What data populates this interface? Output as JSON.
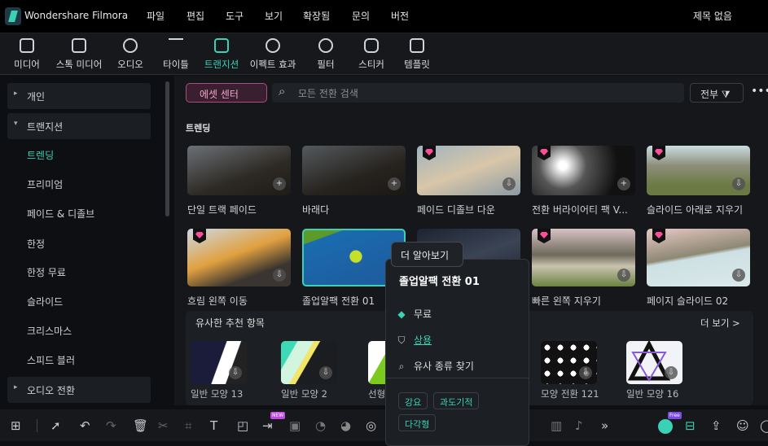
{
  "app": {
    "title": "Wondershare Filmora",
    "project_title": "제목 없음"
  },
  "menu": [
    "파일",
    "편집",
    "도구",
    "보기",
    "확장됨",
    "문의",
    "버전"
  ],
  "toolbar": [
    {
      "label": "미디어",
      "icon": "media-icon"
    },
    {
      "label": "스톡 미디어",
      "icon": "stock-icon"
    },
    {
      "label": "오디오",
      "icon": "audio-icon"
    },
    {
      "label": "타이틀",
      "icon": "title-icon"
    },
    {
      "label": "트랜지션",
      "icon": "transition-icon",
      "active": true
    },
    {
      "label": "이펙트 효과",
      "icon": "effects-icon"
    },
    {
      "label": "필터",
      "icon": "filter-icon"
    },
    {
      "label": "스티커",
      "icon": "sticker-icon"
    },
    {
      "label": "템플릿",
      "icon": "template-icon"
    }
  ],
  "sidebar": {
    "items": [
      "개인",
      "트랜지션",
      "트렌딩",
      "프리미엄",
      "페이드 & 디졸브",
      "한정",
      "한정 무료",
      "슬라이드",
      "크리스마스",
      "스피드 블러",
      "오디오 전환"
    ]
  },
  "top": {
    "asset_center": "에셋 센터",
    "search_placeholder": "모든 전환 검색",
    "filter_all": "전부"
  },
  "section_title": "트렌딩",
  "cards": [
    "단일 트랙 페이드",
    "바래다",
    "페이드 디졸브 다운",
    "전환 버라이어티 팩 V...",
    "슬라이드 아래로 지우기",
    "흐림 왼쪽 이동",
    "졸업알팩 전환 01",
    "",
    "빠른 왼쪽 지우기",
    "페이지 슬라이드 02"
  ],
  "recommend": {
    "title": "유사한 추천 항목",
    "more": "더 보기 >",
    "items": [
      "일반 모양 13",
      "일반 모양 2",
      "선형",
      "",
      "",
      "모양 전환 121",
      "일반 모양 16"
    ]
  },
  "tooltip": "더 알아보기",
  "popup": {
    "title": "졸업알팩 전환 01",
    "price": "무료",
    "license": "상용",
    "find_similar": "유사 종류 찾기",
    "tags": [
      "강요",
      "과도기적",
      "다각형"
    ]
  },
  "bottom": {
    "new_badge": "NEW",
    "free_badge": "Free"
  },
  "colors": {
    "accent": "#3ad1b4",
    "premium": "#ff4d9a"
  }
}
